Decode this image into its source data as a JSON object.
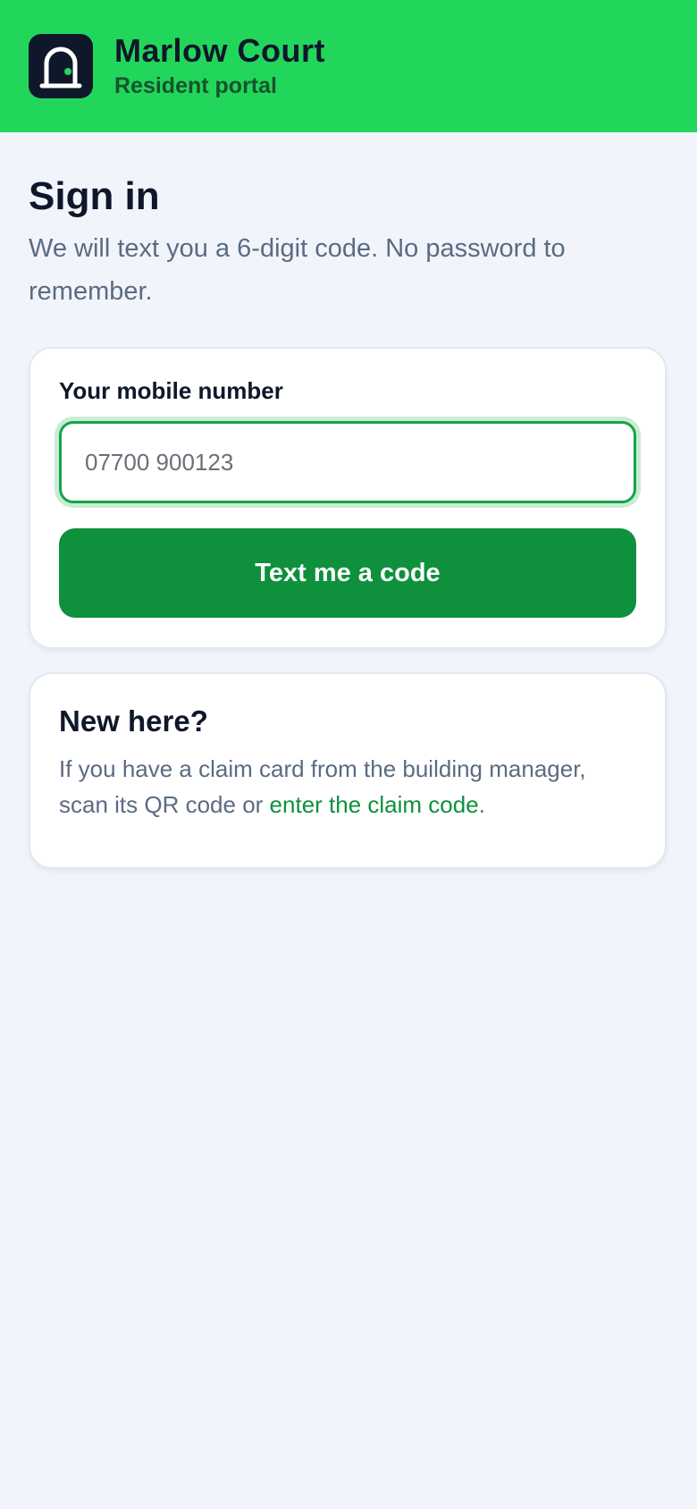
{
  "header": {
    "app_name": "Marlow Court",
    "subtitle": "Resident portal",
    "logo_icon": "door-icon"
  },
  "signin": {
    "title": "Sign in",
    "description": "We will text you a 6-digit code. No password to remember.",
    "phone_label": "Your mobile number",
    "phone_value": "",
    "phone_placeholder": "07700 900123",
    "submit_label": "Text me a code"
  },
  "new_here": {
    "title": "New here?",
    "text_before": "If you have a claim card from the building manager, scan its QR code or ",
    "link_label": "enter the claim code",
    "text_after": "."
  },
  "colors": {
    "header_bg": "#22d65c",
    "primary": "#0e903d",
    "page_bg": "#f1f5fb",
    "text": "#0f172a",
    "muted": "#5b6b82"
  }
}
